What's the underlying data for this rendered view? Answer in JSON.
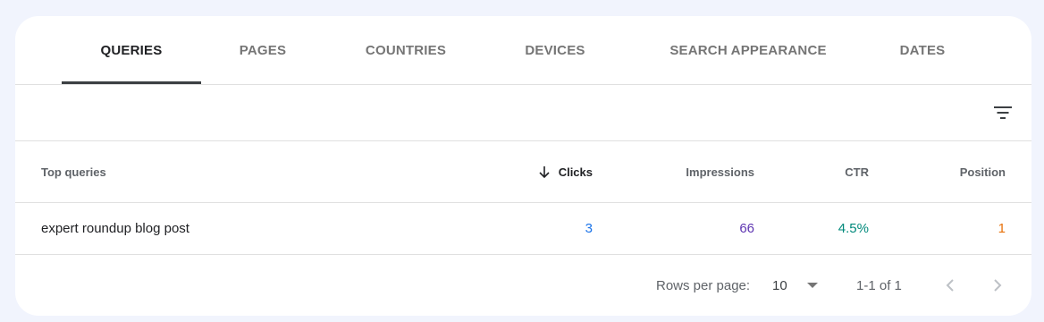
{
  "tabs": [
    {
      "label": "QUERIES",
      "active": true
    },
    {
      "label": "PAGES"
    },
    {
      "label": "COUNTRIES"
    },
    {
      "label": "DEVICES"
    },
    {
      "label": "SEARCH APPEARANCE"
    },
    {
      "label": "DATES"
    }
  ],
  "toolbar": {
    "filter_icon": "filter-list-icon"
  },
  "table": {
    "columns": [
      {
        "label": "Top queries"
      },
      {
        "label": "Clicks",
        "sorted": "descending",
        "icon": "arrow-down-icon"
      },
      {
        "label": "Impressions"
      },
      {
        "label": "CTR"
      },
      {
        "label": "Position"
      }
    ],
    "rows": [
      {
        "query": "expert roundup blog post",
        "clicks": "3",
        "impressions": "66",
        "ctr": "4.5%",
        "position": "1"
      }
    ]
  },
  "pagination": {
    "rows_per_page_label": "Rows per page:",
    "rows_per_page_value": "10",
    "range_text": "1-1 of 1"
  },
  "colors": {
    "clicks": "#1a73e8",
    "impressions": "#5e35b1",
    "ctr": "#00897b",
    "position": "#e8710a"
  }
}
